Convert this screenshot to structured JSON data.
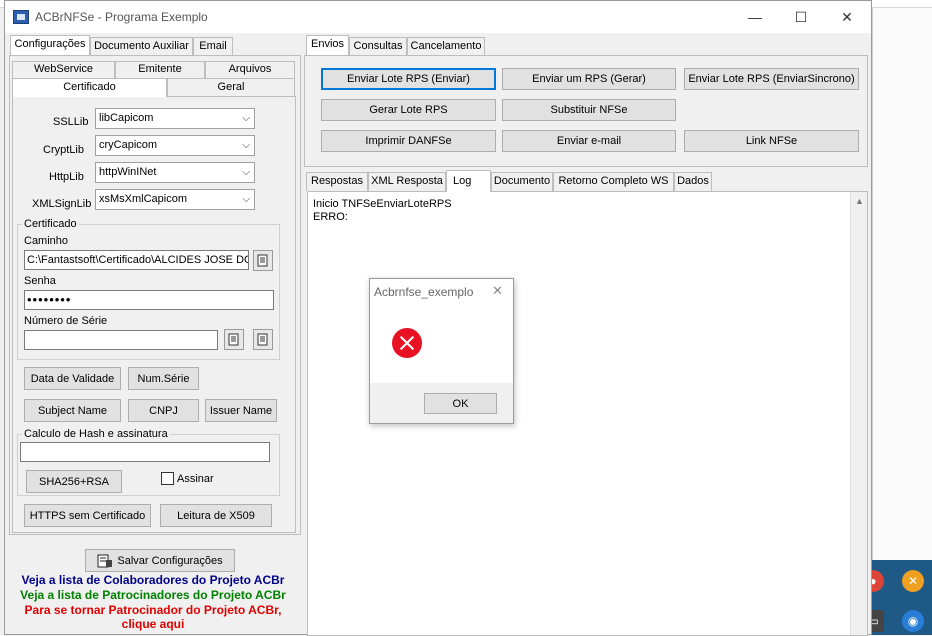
{
  "window": {
    "title": "ACBrNFSe - Programa Exemplo",
    "minimize": "—",
    "maximize": "☐",
    "close": "✕"
  },
  "left_tabs": [
    "Configurações",
    "Documento Auxiliar",
    "Email"
  ],
  "inner_tabs_row1": [
    "WebService",
    "Emitente",
    "Arquivos"
  ],
  "inner_tabs_row2": [
    "Certificado",
    "Geral"
  ],
  "libs": {
    "ssl_label": "SSLLib",
    "ssl_value": "libCapicom",
    "crypt_label": "CryptLib",
    "crypt_value": "cryCapicom",
    "http_label": "HttpLib",
    "http_value": "httpWinINet",
    "xml_label": "XMLSignLib",
    "xml_value": "xsMsXmlCapicom"
  },
  "certificado": {
    "group_title": "Certificado",
    "caminho_label": "Caminho",
    "caminho_value": "C:\\Fantastsoft\\Certificado\\ALCIDES JOSE DO",
    "senha_label": "Senha",
    "senha_value": "••••••••",
    "serie_label": "Número de Série",
    "serie_value": ""
  },
  "cert_buttons": {
    "data_validade": "Data de Validade",
    "num_serie": "Num.Série",
    "subject_name": "Subject Name",
    "cnpj": "CNPJ",
    "issuer_name": "Issuer Name"
  },
  "hash": {
    "group_title": "Calculo de Hash e assinatura",
    "input_value": "",
    "sha_button": "SHA256+RSA",
    "assinar_label": "Assinar"
  },
  "bottom_buttons": {
    "https": "HTTPS sem Certificado",
    "x509": "Leitura de X509",
    "salvar": "Salvar Configurações"
  },
  "links": {
    "colaboradores": "Veja a lista de Colaboradores do Projeto ACBr",
    "patrocinadores": "Veja a lista de Patrocinadores do Projeto ACBr",
    "tornar_1": "Para se tornar Patrocinador do Projeto ACBr,",
    "tornar_2": "clique aqui",
    "color_blue": "#00008b",
    "color_green": "#008000",
    "color_red": "#e00000"
  },
  "right_tabs": [
    "Envios",
    "Consultas",
    "Cancelamento"
  ],
  "actions": {
    "enviar_lote": "Enviar Lote RPS (Enviar)",
    "enviar_um": "Enviar um RPS (Gerar)",
    "enviar_sincrono": "Enviar Lote RPS (EnviarSincrono)",
    "gerar_lote": "Gerar Lote RPS",
    "substituir": "Substituir NFSe",
    "imprimir": "Imprimir DANFSe",
    "enviar_email": "Enviar e-mail",
    "link": "Link NFSe"
  },
  "result_tabs": [
    "Respostas",
    "XML Resposta",
    "Log",
    "Documento",
    "Retorno Completo WS",
    "Dados"
  ],
  "log": {
    "line1": "Inicio TNFSeEnviarLoteRPS",
    "line2": "ERRO:"
  },
  "dialog": {
    "title": "Acbrnfse_exemplo",
    "close": "✕",
    "ok": "OK"
  }
}
